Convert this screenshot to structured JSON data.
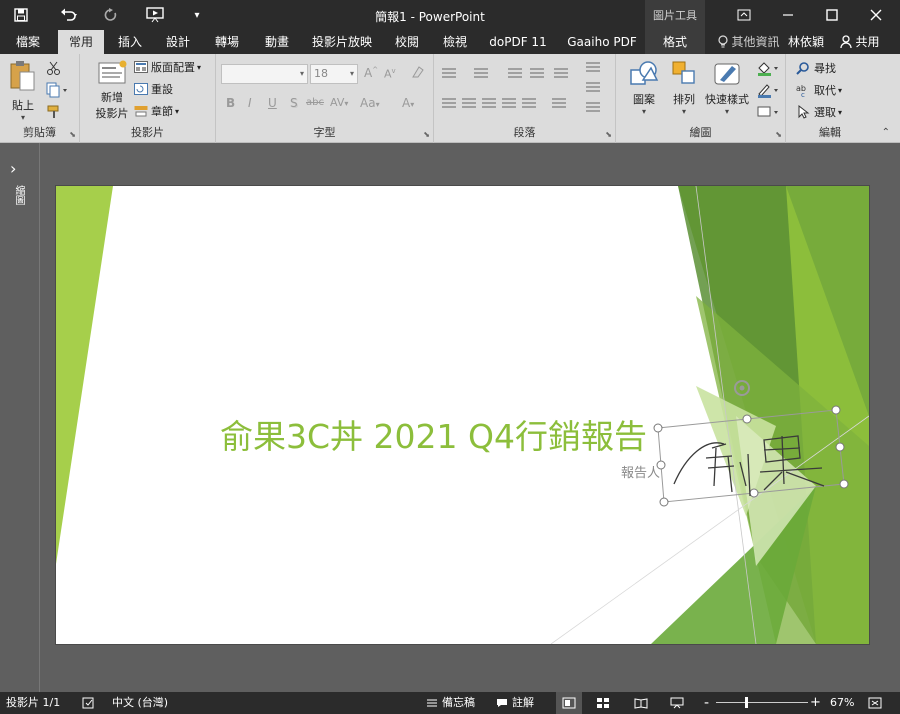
{
  "titlebar": {
    "title": "簡報1 - PowerPoint",
    "context_tab": "圖片工具",
    "save_icon": "save-icon",
    "undo_icon": "undo-icon",
    "redo_icon": "redo-icon",
    "present_icon": "present-from-start-icon"
  },
  "tabs": [
    "檔案",
    "常用",
    "插入",
    "設計",
    "轉場",
    "動畫",
    "投影片放映",
    "校閱",
    "檢視",
    "doPDF 11",
    "Gaaiho PDF",
    "格式"
  ],
  "tell_me": "其他資訊",
  "user_name": "林依穎",
  "share_label": "共用",
  "ribbon": {
    "clipboard": {
      "paste": "貼上",
      "group": "剪貼簿"
    },
    "slides": {
      "new_slide_1": "新增",
      "new_slide_2": "投影片",
      "layout": "版面配置",
      "reset": "重設",
      "section": "章節",
      "group": "投影片"
    },
    "font": {
      "font_name": "",
      "font_size": "18",
      "group": "字型",
      "bold": "B",
      "italic": "I",
      "underline": "U",
      "shadow": "S",
      "strike": "abc",
      "spacing": "AV",
      "case": "Aa",
      "color": "A",
      "grow": "A",
      "shrink": "A"
    },
    "paragraph": {
      "group": "段落"
    },
    "drawing": {
      "shapes": "圖案",
      "arrange": "排列",
      "quick_styles": "快速樣式",
      "group": "繪圖"
    },
    "editing": {
      "find": "尋找",
      "replace": "取代",
      "select": "選取",
      "group": "編輯"
    }
  },
  "leftpane": {
    "label": "縮圖"
  },
  "slide": {
    "title": "俞果3C丼 2021 Q4行銷報告",
    "subtitle_fragment": "報告人",
    "signature_text": "俞果"
  },
  "status": {
    "slide_info": "投影片 1/1",
    "language": "中文 (台灣)",
    "notes": "備忘稿",
    "comments": "註解",
    "zoom_pct": "67%",
    "zoom_minus": "-",
    "zoom_plus": "+",
    "zoom_level": 0.67
  },
  "colors": {
    "green_dark": "#5a8f35",
    "green_mid": "#8cbe3b",
    "green_light": "#c9e2a0",
    "title_green": "#8cbe3b"
  }
}
